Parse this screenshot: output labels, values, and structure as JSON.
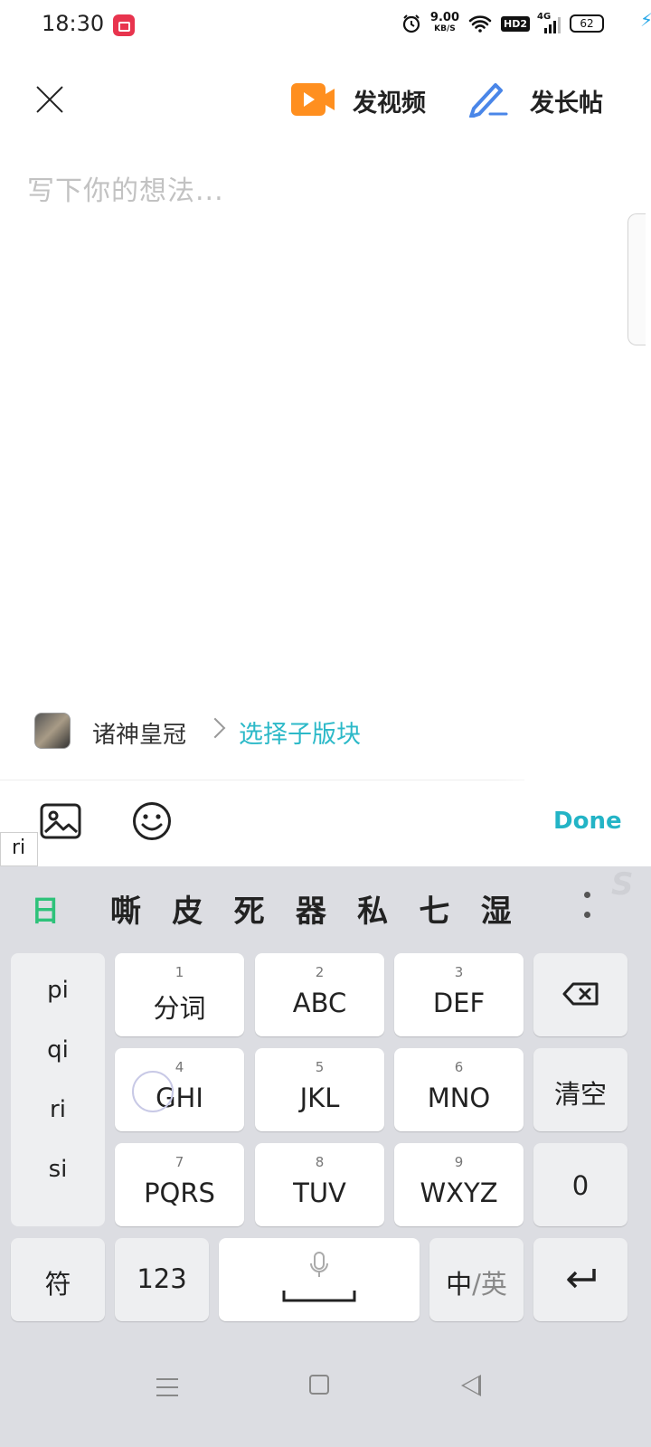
{
  "status_bar": {
    "time": "18:30",
    "net_speed": "9.00",
    "net_unit": "KB/S",
    "hd_badge": "HD2",
    "signal": "4G",
    "battery": "62"
  },
  "header": {
    "video_label": "发视频",
    "long_post_label": "发长帖"
  },
  "editor": {
    "placeholder": "写下你的想法..."
  },
  "forum": {
    "name": "诸神皇冠",
    "sub_forum_link": "选择子版块"
  },
  "toolbar": {
    "done_label": "Done",
    "composing": "ri"
  },
  "keyboard": {
    "candidates": [
      "嘶",
      "皮",
      "死",
      "器",
      "私",
      "七",
      "湿"
    ],
    "pinyin_options": [
      "pi",
      "qi",
      "ri",
      "si"
    ],
    "keys": {
      "k1": {
        "num": "1",
        "label": "分词"
      },
      "k2": {
        "num": "2",
        "label": "ABC"
      },
      "k3": {
        "num": "3",
        "label": "DEF"
      },
      "k4": {
        "num": "4",
        "label": "GHI"
      },
      "k5": {
        "num": "5",
        "label": "JKL"
      },
      "k6": {
        "num": "6",
        "label": "MNO"
      },
      "k7": {
        "num": "7",
        "label": "PQRS"
      },
      "k8": {
        "num": "8",
        "label": "TUV"
      },
      "k9": {
        "num": "9",
        "label": "WXYZ"
      }
    },
    "clear": "清空",
    "zero": "0",
    "symbols": "符",
    "numbers": "123",
    "lang_zh": "中",
    "lang_sep": "/",
    "lang_en": "英"
  },
  "colors": {
    "accent_teal": "#23b4c6",
    "video_orange": "#ff8f1f",
    "pen_blue": "#4a86e8",
    "keyboard_bg": "#dcdde2"
  }
}
